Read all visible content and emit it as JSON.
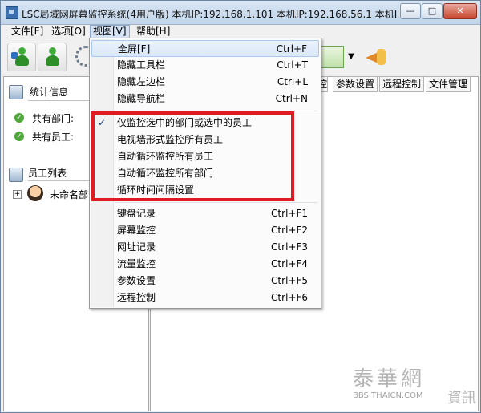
{
  "window": {
    "title": "LSC局域网屏幕监控系统(4用户版)   本机IP:192.168.1.101   本机IP:192.168.56.1   本机IP..."
  },
  "title_buttons": {
    "minimize": "—",
    "maximize": "□",
    "close": "✕"
  },
  "menubar": [
    {
      "label": "文件[F]"
    },
    {
      "label": "选项[O]"
    },
    {
      "label": "视图[V]"
    },
    {
      "label": "帮助[H]"
    }
  ],
  "toolbar": {
    "dropdown_arrow": "▼"
  },
  "left_panel": {
    "stats_title": "统计信息",
    "departments_label": "共有部门:",
    "employees_label": "共有员工:",
    "employee_list_title": "员工列表",
    "tree_expander": "+",
    "tree_root": "未命名部门"
  },
  "tabs": [
    {
      "label": "控"
    },
    {
      "label": "参数设置"
    },
    {
      "label": "远程控制"
    },
    {
      "label": "文件管理"
    }
  ],
  "view_menu": {
    "items": [
      {
        "label": "全屏[F]",
        "shortcut": "Ctrl+F"
      },
      {
        "label": "隐藏工具栏",
        "shortcut": "Ctrl+T"
      },
      {
        "label": "隐藏左边栏",
        "shortcut": "Ctrl+L"
      },
      {
        "label": "隐藏导航栏",
        "shortcut": "Ctrl+N"
      },
      {
        "label": "仅监控选中的部门或选中的员工",
        "shortcut": "",
        "checked": true
      },
      {
        "label": "电视墙形式监控所有员工",
        "shortcut": ""
      },
      {
        "label": "自动循环监控所有员工",
        "shortcut": ""
      },
      {
        "label": "自动循环监控所有部门",
        "shortcut": ""
      },
      {
        "label": "循环时间间隔设置",
        "shortcut": ""
      },
      {
        "label": "键盘记录",
        "shortcut": "Ctrl+F1"
      },
      {
        "label": "屏幕监控",
        "shortcut": "Ctrl+F2"
      },
      {
        "label": "网址记录",
        "shortcut": "Ctrl+F3"
      },
      {
        "label": "流量监控",
        "shortcut": "Ctrl+F4"
      },
      {
        "label": "参数设置",
        "shortcut": "Ctrl+F5"
      },
      {
        "label": "远程控制",
        "shortcut": "Ctrl+F6"
      }
    ],
    "check_glyph": "✓"
  },
  "colors": {
    "highlight_box": "#e11b22"
  },
  "watermark": {
    "chinese": "泰華網",
    "suffix": "資訊",
    "url": "BBS.THAICN.COM"
  }
}
